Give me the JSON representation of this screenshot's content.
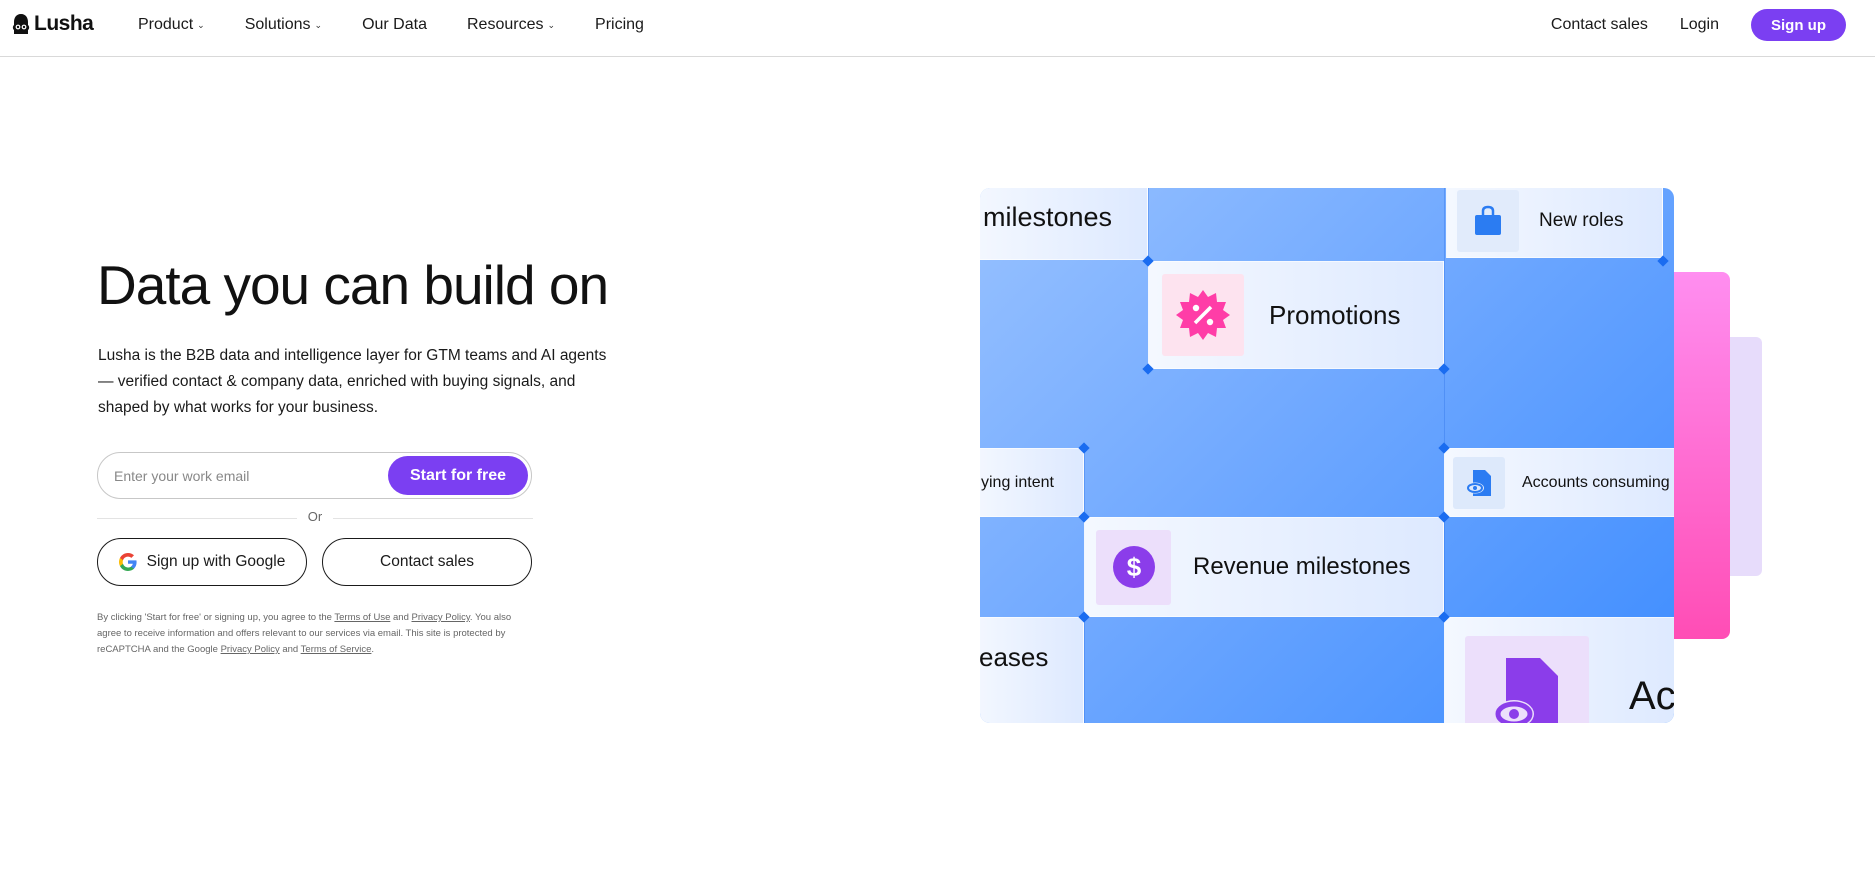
{
  "nav": {
    "logo": "Lusha",
    "links": [
      {
        "label": "Product",
        "has_dropdown": true
      },
      {
        "label": "Solutions",
        "has_dropdown": true
      },
      {
        "label": "Our Data",
        "has_dropdown": false
      },
      {
        "label": "Resources",
        "has_dropdown": true
      },
      {
        "label": "Pricing",
        "has_dropdown": false
      }
    ],
    "contact_sales": "Contact sales",
    "login": "Login",
    "signup": "Sign up"
  },
  "hero": {
    "title": "Data you can build on",
    "description": "Lusha is the B2B data and intelligence layer for GTM teams and AI agents — verified contact & company data, enriched with buying signals, and shaped by what works for your business.",
    "email_placeholder": "Enter your work email",
    "start_button": "Start for free",
    "or_label": "Or",
    "google_button": "Sign up with Google",
    "contact_button": "Contact sales",
    "legal": {
      "part1": "By clicking 'Start for free' or signing up, you agree to the ",
      "terms_of_use": "Terms of Use",
      "part2": " and ",
      "privacy_policy": "Privacy Policy",
      "part3": ". You also agree to receive information and offers relevant to our services via email. This site is protected by reCAPTCHA and the Google ",
      "google_privacy": "Privacy Policy",
      "part4": " and ",
      "terms_of_service": "Terms of Service",
      "part5": "."
    }
  },
  "illustration": {
    "tiles": {
      "milestones": "milestones",
      "new_roles": "New roles",
      "promotions": "Promotions",
      "buying_intent": "ying intent",
      "accounts_consuming": "Accounts consuming",
      "revenue_milestones": "Revenue milestones",
      "releases": "eases",
      "ac": "Ac"
    },
    "colors": {
      "accent": "#7b3ff2",
      "tile_blue": "#3d8cff",
      "promo_pink": "#ff3da7",
      "revenue_purple": "#8b3dea"
    }
  }
}
